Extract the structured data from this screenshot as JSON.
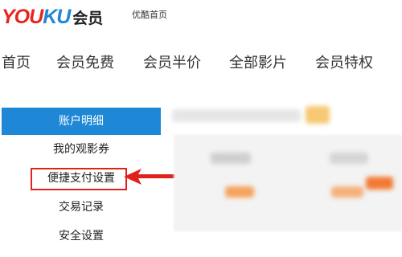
{
  "header": {
    "logo": {
      "part1": "YOU",
      "part2": "KU",
      "member": "会员"
    },
    "home_link": "优酷首页"
  },
  "nav": {
    "items": [
      {
        "label": "首页"
      },
      {
        "label": "会员免费"
      },
      {
        "label": "会员半价"
      },
      {
        "label": "全部影片"
      },
      {
        "label": "会员特权"
      }
    ]
  },
  "sidebar": {
    "items": [
      {
        "label": "账户明细",
        "active": true
      },
      {
        "label": "我的观影券",
        "active": false
      },
      {
        "label": "便捷支付设置",
        "active": false,
        "highlighted": true
      },
      {
        "label": "交易记录",
        "active": false
      },
      {
        "label": "安全设置",
        "active": false
      }
    ]
  },
  "colors": {
    "brand_red": "#e8261f",
    "brand_blue": "#1e88d6",
    "highlight_red": "#e0221c",
    "blur_orange": "#f5a25c"
  }
}
